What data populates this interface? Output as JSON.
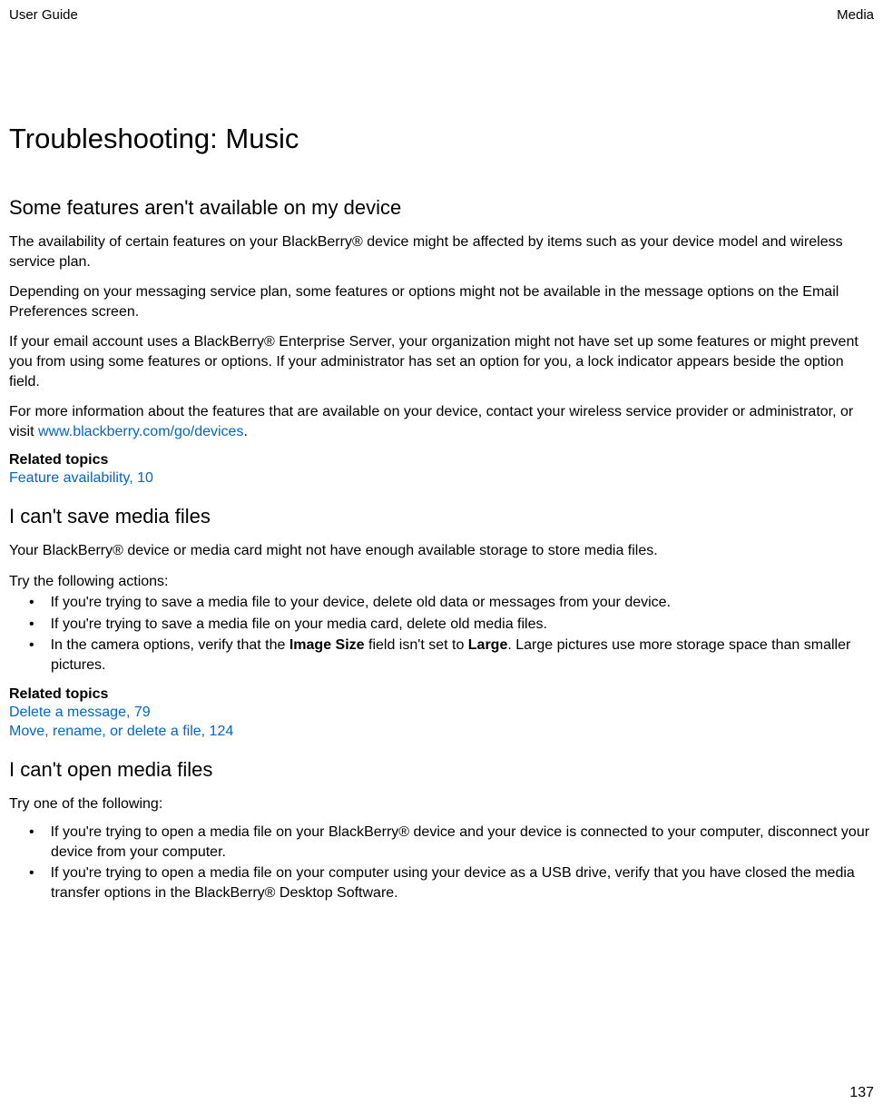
{
  "header": {
    "left": "User Guide",
    "right": "Media"
  },
  "title": "Troubleshooting: Music",
  "section1": {
    "heading": "Some features aren't available on my device",
    "p1": "The availability of certain features on your BlackBerry® device might be affected by items such as your device model and wireless service plan.",
    "p2": "Depending on your messaging service plan, some features or options might not be available in the message options on the Email Preferences screen.",
    "p3": "If your email account uses a BlackBerry® Enterprise Server, your organization might not have set up some features or might prevent you from using some features or options. If your administrator has set an option for you, a lock indicator appears beside the option field.",
    "p4_before": "For more information about the features that are available on your device, contact your wireless service provider or administrator, or visit ",
    "p4_link": "www.blackberry.com/go/devices",
    "p4_after": ".",
    "related_label": "Related topics",
    "related_link1": "Feature availability, 10"
  },
  "section2": {
    "heading": "I can't save media files",
    "p1": "Your BlackBerry® device or media card might not have enough available storage to store media files.",
    "p2": "Try the following actions:",
    "li1": "If you're trying to save a media file to your device, delete old data or messages from your device.",
    "li2": "If you're trying to save a media file on your media card, delete old media files.",
    "li3_before": "In the camera options, verify that the ",
    "li3_bold1": "Image Size",
    "li3_mid": " field isn't set to ",
    "li3_bold2": "Large",
    "li3_after": ". Large pictures use more storage space than smaller pictures.",
    "related_label": "Related topics",
    "related_link1": "Delete a message, 79",
    "related_link2": "Move, rename, or delete a file, 124"
  },
  "section3": {
    "heading": "I can't open media files",
    "p1": "Try one of the following:",
    "li1": "If you're trying to open a media file on your BlackBerry® device and your device is connected to your computer, disconnect your device from your computer.",
    "li2": "If you're trying to open a media file on your computer using your device as a USB drive, verify that you have closed the media transfer options in the BlackBerry® Desktop Software."
  },
  "footer": {
    "page": "137"
  }
}
